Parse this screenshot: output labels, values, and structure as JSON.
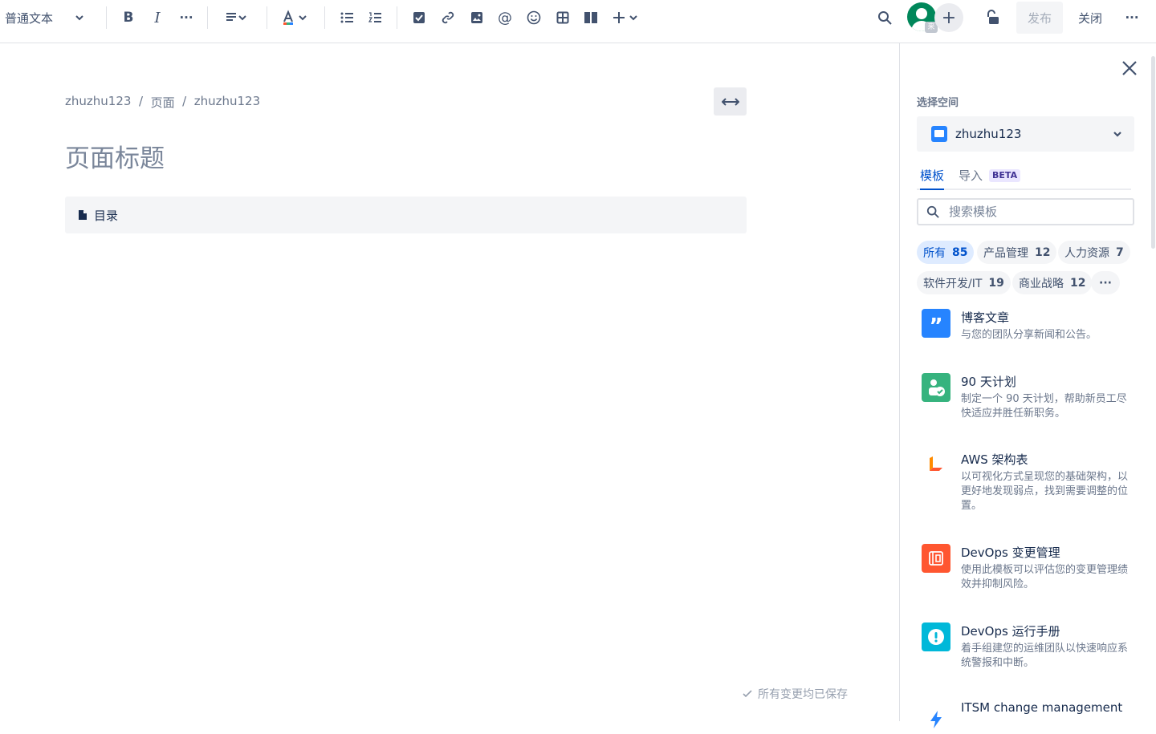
{
  "toolbar": {
    "text_style": "普通文本",
    "publish_label": "发布",
    "close_label": "关闭",
    "avatar_badge": "来"
  },
  "editor": {
    "breadcrumb": [
      "zhuzhu123",
      "页面",
      "zhuzhu123"
    ],
    "breadcrumb_sep": "/",
    "title_placeholder": "页面标题",
    "toc_label": "目录",
    "saved_status": "所有变更均已保存"
  },
  "panel": {
    "space_label": "选择空间",
    "space_value": "zhuzhu123",
    "tabs": [
      {
        "label": "模板",
        "active": true
      },
      {
        "label": "导入",
        "badge": "BETA"
      }
    ],
    "search_placeholder": "搜索模板",
    "categories": [
      {
        "label": "所有",
        "count": "85",
        "active": true
      },
      {
        "label": "产品管理",
        "count": "12"
      },
      {
        "label": "人力资源",
        "count": "7"
      },
      {
        "label": "软件开发/IT",
        "count": "19"
      },
      {
        "label": "商业战略",
        "count": "12"
      }
    ],
    "templates": [
      {
        "name": "博客文章",
        "desc": "与您的团队分享新闻和公告。",
        "icon": "quote-icon",
        "color": "#2684ff"
      },
      {
        "name": "90 天计划",
        "desc": "制定一个 90 天计划，帮助新员工尽快适应并胜任新职务。",
        "icon": "person-check-icon",
        "color": "#36b37e"
      },
      {
        "name": "AWS 架构表",
        "desc": "以可视化方式呈现您的基础架构，以更好地发现弱点，找到需要调整的位置。",
        "icon": "lucid-icon",
        "color": "#ff8b00"
      },
      {
        "name": "DevOps 变更管理",
        "desc": "使用此模板可以评估您的变更管理绩效并抑制风险。",
        "icon": "clipboard-icon",
        "color": "#ff5630"
      },
      {
        "name": "DevOps 运行手册",
        "desc": "着手组建您的运维团队以快速响应系统警报和中断。",
        "icon": "alert-icon",
        "color": "#00b8d9"
      },
      {
        "name": "ITSM change management",
        "desc": "",
        "icon": "bolt-icon",
        "color": "#2684ff"
      }
    ]
  }
}
